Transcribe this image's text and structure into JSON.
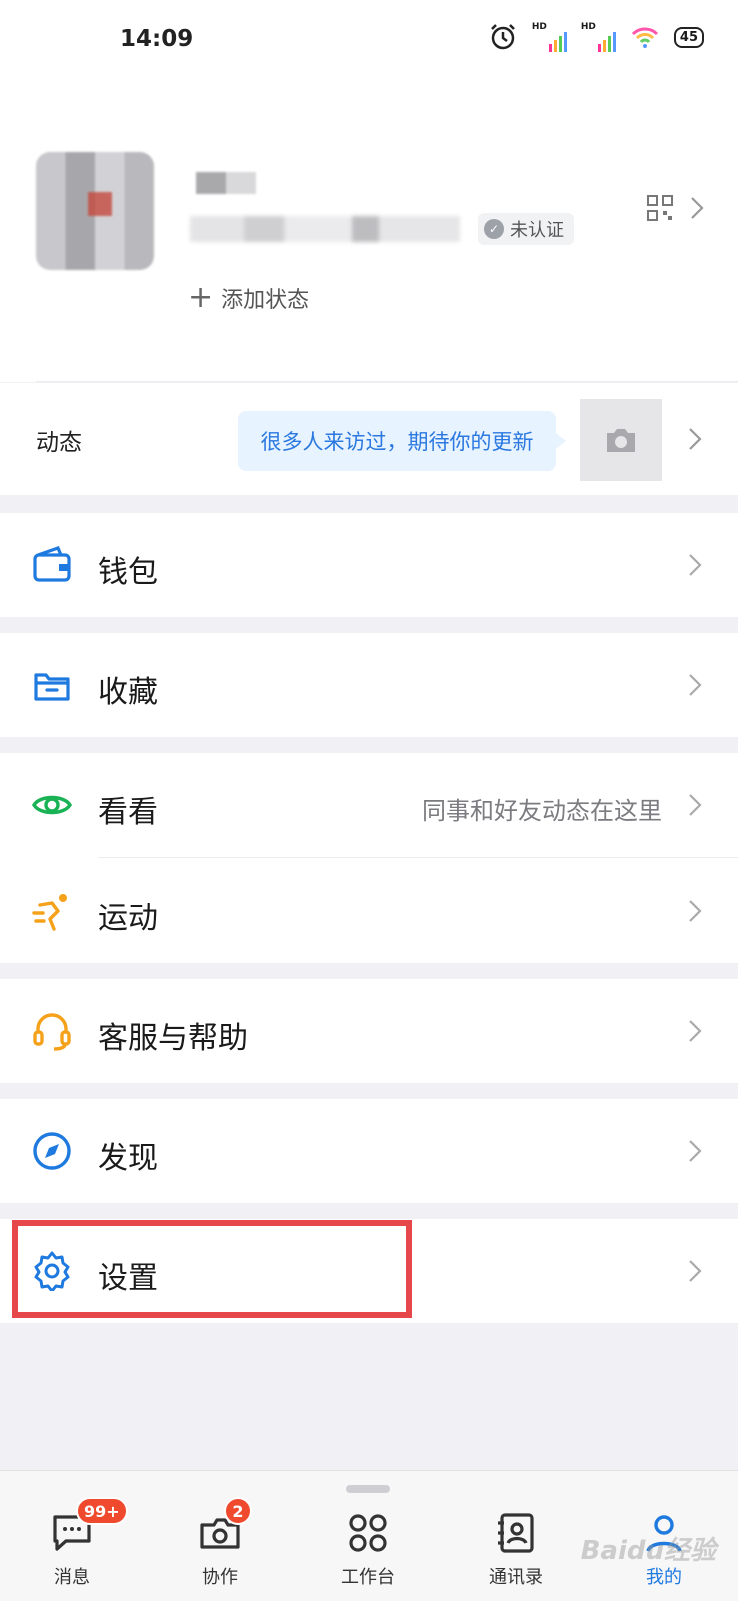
{
  "status_bar": {
    "time": "14:09",
    "signal1_label": "HD",
    "signal2_label": "HD",
    "battery": "45"
  },
  "profile": {
    "verify_label": "未认证",
    "add_status_label": "添加状态"
  },
  "dynamic": {
    "label": "动态",
    "bubble_text": "很多人来访过，期待你的更新"
  },
  "menu": [
    {
      "label": "钱包",
      "icon": "wallet-icon"
    },
    {
      "label": "收藏",
      "icon": "folder-icon"
    },
    {
      "label": "看看",
      "desc": "同事和好友动态在这里",
      "icon": "eye-icon"
    },
    {
      "label": "运动",
      "icon": "run-icon"
    },
    {
      "label": "客服与帮助",
      "icon": "headset-icon"
    },
    {
      "label": "发现",
      "icon": "compass-icon"
    },
    {
      "label": "设置",
      "icon": "gear-icon"
    }
  ],
  "tabbar": [
    {
      "label": "消息",
      "badge": "99+"
    },
    {
      "label": "协作",
      "badge": "2"
    },
    {
      "label": "工作台"
    },
    {
      "label": "通讯录"
    },
    {
      "label": "我的"
    }
  ],
  "watermark": "Baidu经验",
  "colors": {
    "accent_blue": "#1f7ae0",
    "green": "#19b255",
    "orange": "#f5a11a",
    "badge_red": "#f04a2e",
    "highlight_red": "#e5474a"
  }
}
